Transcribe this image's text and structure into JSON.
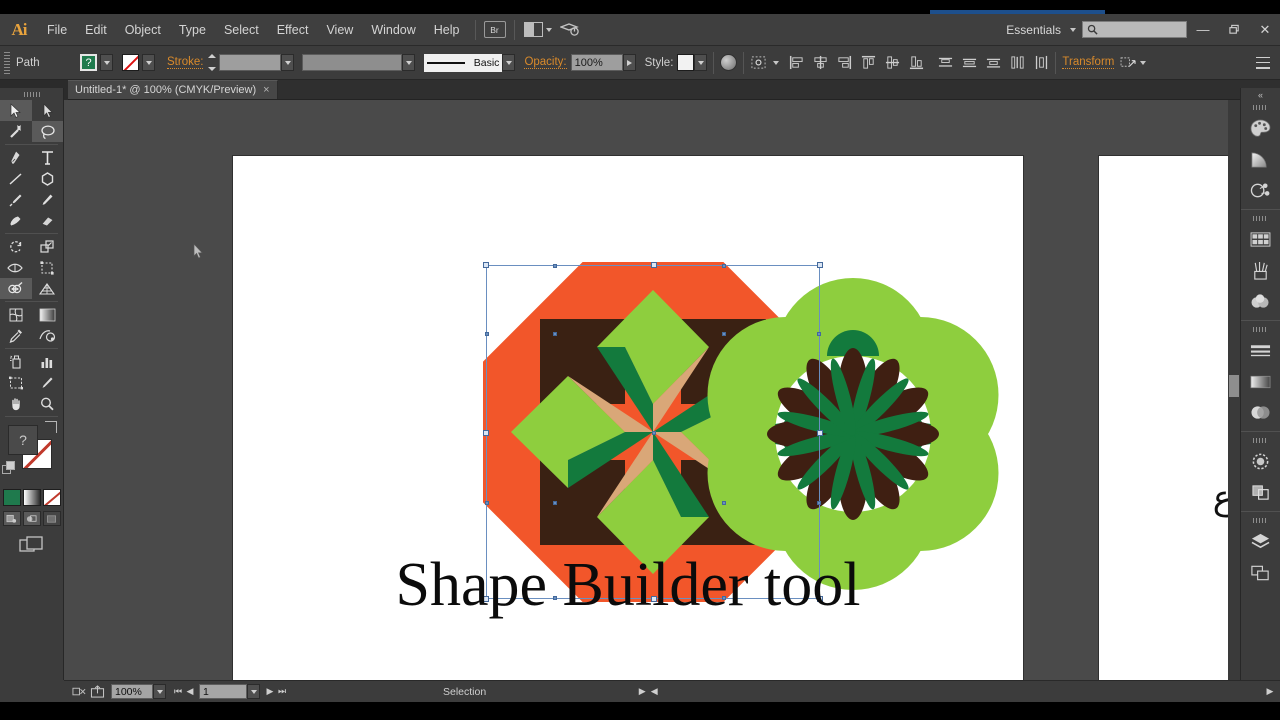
{
  "app": {
    "name": "Adobe Illustrator",
    "logo_text": "Ai"
  },
  "menubar": {
    "items": [
      "File",
      "Edit",
      "Object",
      "Type",
      "Select",
      "Effect",
      "View",
      "Window",
      "Help"
    ],
    "bridge_button": "Br",
    "arrange_documents_label": "arrange-documents",
    "workspace": "Essentials",
    "search_placeholder": "",
    "window_controls": {
      "minimize": "—",
      "restore": "❐",
      "close": "✕"
    }
  },
  "controlbar": {
    "selection_type": "Path",
    "fill_label": "fill-swatch",
    "fill_glyph": "?",
    "stroke_swatch_label": "stroke-none",
    "stroke_label": "Stroke:",
    "stroke_weight": "",
    "stroke_profile": "",
    "brush_name": "Basic",
    "opacity_label": "Opacity:",
    "opacity_value": "100%",
    "style_label": "Style:",
    "transform_label": "Transform",
    "align_icons": [
      "align-left",
      "align-center-horizontal",
      "align-right",
      "align-top-edge",
      "align-vertical-center",
      "align-bottom-edge",
      "distribute-top",
      "distribute-vertical-center",
      "distribute-bottom",
      "distribute-spacing-horizontal",
      "distribute-spacing-vertical"
    ]
  },
  "document_tab": {
    "title": "Untitled-1* @ 100% (CMYK/Preview)",
    "close": "×"
  },
  "toolbar": {
    "tools": [
      {
        "name": "selection-tool",
        "selected": true
      },
      {
        "name": "direct-selection-tool",
        "selected": false
      },
      {
        "name": "magic-wand-tool",
        "selected": false
      },
      {
        "name": "lasso-tool",
        "selected": false
      },
      {
        "name": "pen-tool",
        "selected": false
      },
      {
        "name": "type-tool",
        "selected": false
      },
      {
        "name": "line-segment-tool",
        "selected": false
      },
      {
        "name": "rectangle-tool",
        "selected": false
      },
      {
        "name": "paintbrush-tool",
        "selected": false
      },
      {
        "name": "pencil-tool",
        "selected": false
      },
      {
        "name": "blob-brush-tool",
        "selected": false
      },
      {
        "name": "eraser-tool",
        "selected": false
      },
      {
        "name": "rotate-tool",
        "selected": false
      },
      {
        "name": "scale-tool",
        "selected": false
      },
      {
        "name": "width-tool",
        "selected": false
      },
      {
        "name": "free-transform-tool",
        "selected": false
      },
      {
        "name": "shape-builder-tool",
        "selected": true
      },
      {
        "name": "perspective-grid-tool",
        "selected": false
      },
      {
        "name": "mesh-tool",
        "selected": false
      },
      {
        "name": "gradient-tool",
        "selected": false
      },
      {
        "name": "eyedropper-tool",
        "selected": false
      },
      {
        "name": "blend-tool",
        "selected": false
      },
      {
        "name": "symbol-sprayer-tool",
        "selected": false
      },
      {
        "name": "column-graph-tool",
        "selected": false
      },
      {
        "name": "artboard-tool",
        "selected": false
      },
      {
        "name": "slice-tool",
        "selected": false
      },
      {
        "name": "hand-tool",
        "selected": false
      },
      {
        "name": "zoom-tool",
        "selected": false
      }
    ],
    "fill_color": "#1f7a4d",
    "fill_glyph": "?",
    "stroke_color": "none",
    "color_modes": [
      "color",
      "gradient",
      "none"
    ],
    "drawing_modes": [
      "draw-normal",
      "draw-behind",
      "draw-inside"
    ],
    "screen_mode": "change-screen-mode"
  },
  "canvas": {
    "caption_text": "Shape Builder tool",
    "second_artboard_glyph": "ع",
    "octagon": {
      "name": "octagon-quilt-artwork",
      "selected": true,
      "colors": {
        "orange": "#f2562a",
        "dark_brown": "#3a2113",
        "light_green": "#8ece3e",
        "dark_green": "#137a3d",
        "tan": "#d9a778"
      }
    },
    "flower": {
      "name": "flower-rosette-artwork",
      "selected": false,
      "colors": {
        "light_green": "#8ece3e",
        "dark_green": "#137a3d",
        "dark_brown": "#3f1f12"
      },
      "petal_count": 6
    }
  },
  "rightdock": {
    "groups": [
      [
        "color-icon",
        "color-guide-icon",
        "symbols-icon"
      ],
      [
        "swatches-icon",
        "brushes-icon",
        "graphic-styles-icon"
      ],
      [
        "stroke-icon",
        "gradient-icon",
        "transparency-icon"
      ],
      [
        "appearance-icon",
        "pathfinder-icon"
      ],
      [
        "layers-icon",
        "artboards-icon"
      ]
    ]
  },
  "statusbar": {
    "zoom_level": "100%",
    "page_number": "1",
    "status_text": "Selection",
    "nav_first": "⏮",
    "nav_prev": "◀",
    "nav_next": "▶",
    "nav_last": "⏭"
  }
}
